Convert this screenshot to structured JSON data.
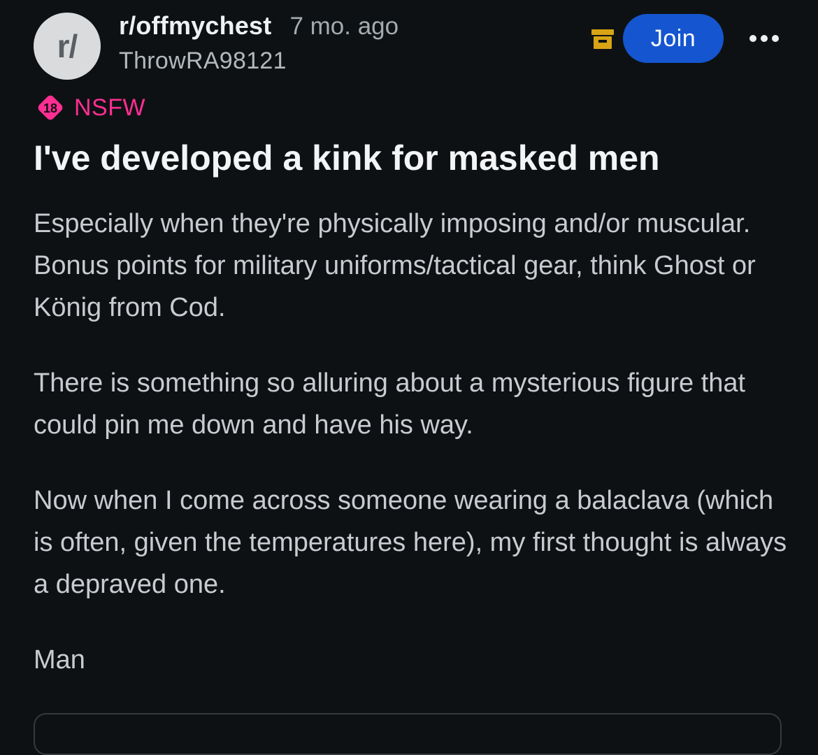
{
  "post_header": {
    "avatar_text": "r/",
    "subreddit": "r/offmychest",
    "age": "7 mo. ago",
    "author": "ThrowRA98121",
    "archive_icon": "archive-icon",
    "join_label": "Join",
    "more_icon": "more-horizontal-icon"
  },
  "nsfw": {
    "badge_text": "18",
    "label": "NSFW"
  },
  "post": {
    "title": "I've developed a kink for masked men",
    "paragraphs": [
      "Especially when they're physically imposing and/or muscular. Bonus points for military uniforms/tactical gear, think Ghost or König from Cod.",
      "There is something so alluring about a mysterious figure that could pin me down and have his way.",
      "Now when I come across someone wearing a balaclava (which is often, given the temperatures here), my first thought is always a depraved one.",
      "Man"
    ]
  },
  "colors": {
    "background": "#0e1113",
    "join_button": "#1556d0",
    "nsfw_accent": "#ff2e93",
    "archive_icon": "#d8a315"
  }
}
